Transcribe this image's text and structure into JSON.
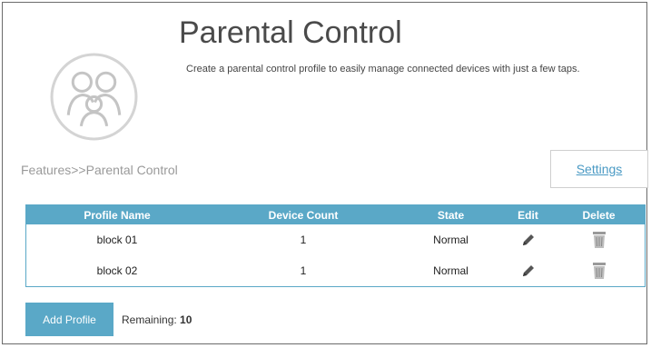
{
  "header": {
    "title": "Parental Control",
    "subtitle": "Create a parental control profile to easily manage connected devices with just a few taps.",
    "logo_icon": "family-icon"
  },
  "breadcrumb": "Features>>Parental Control",
  "settings_label": "Settings",
  "table": {
    "headers": [
      "Profile Name",
      "Device Count",
      "State",
      "Edit",
      "Delete"
    ],
    "rows": [
      {
        "profile_name": "block 01",
        "device_count": "1",
        "state": "Normal",
        "edit_icon": "pencil-icon",
        "delete_icon": "trash-icon"
      },
      {
        "profile_name": "block 02",
        "device_count": "1",
        "state": "Normal",
        "edit_icon": "pencil-icon",
        "delete_icon": "trash-icon"
      }
    ]
  },
  "add_profile_label": "Add Profile",
  "remaining": {
    "label": "Remaining:",
    "value": "10"
  },
  "colors": {
    "accent": "#5aa8c7",
    "link": "#4a9ac4"
  }
}
